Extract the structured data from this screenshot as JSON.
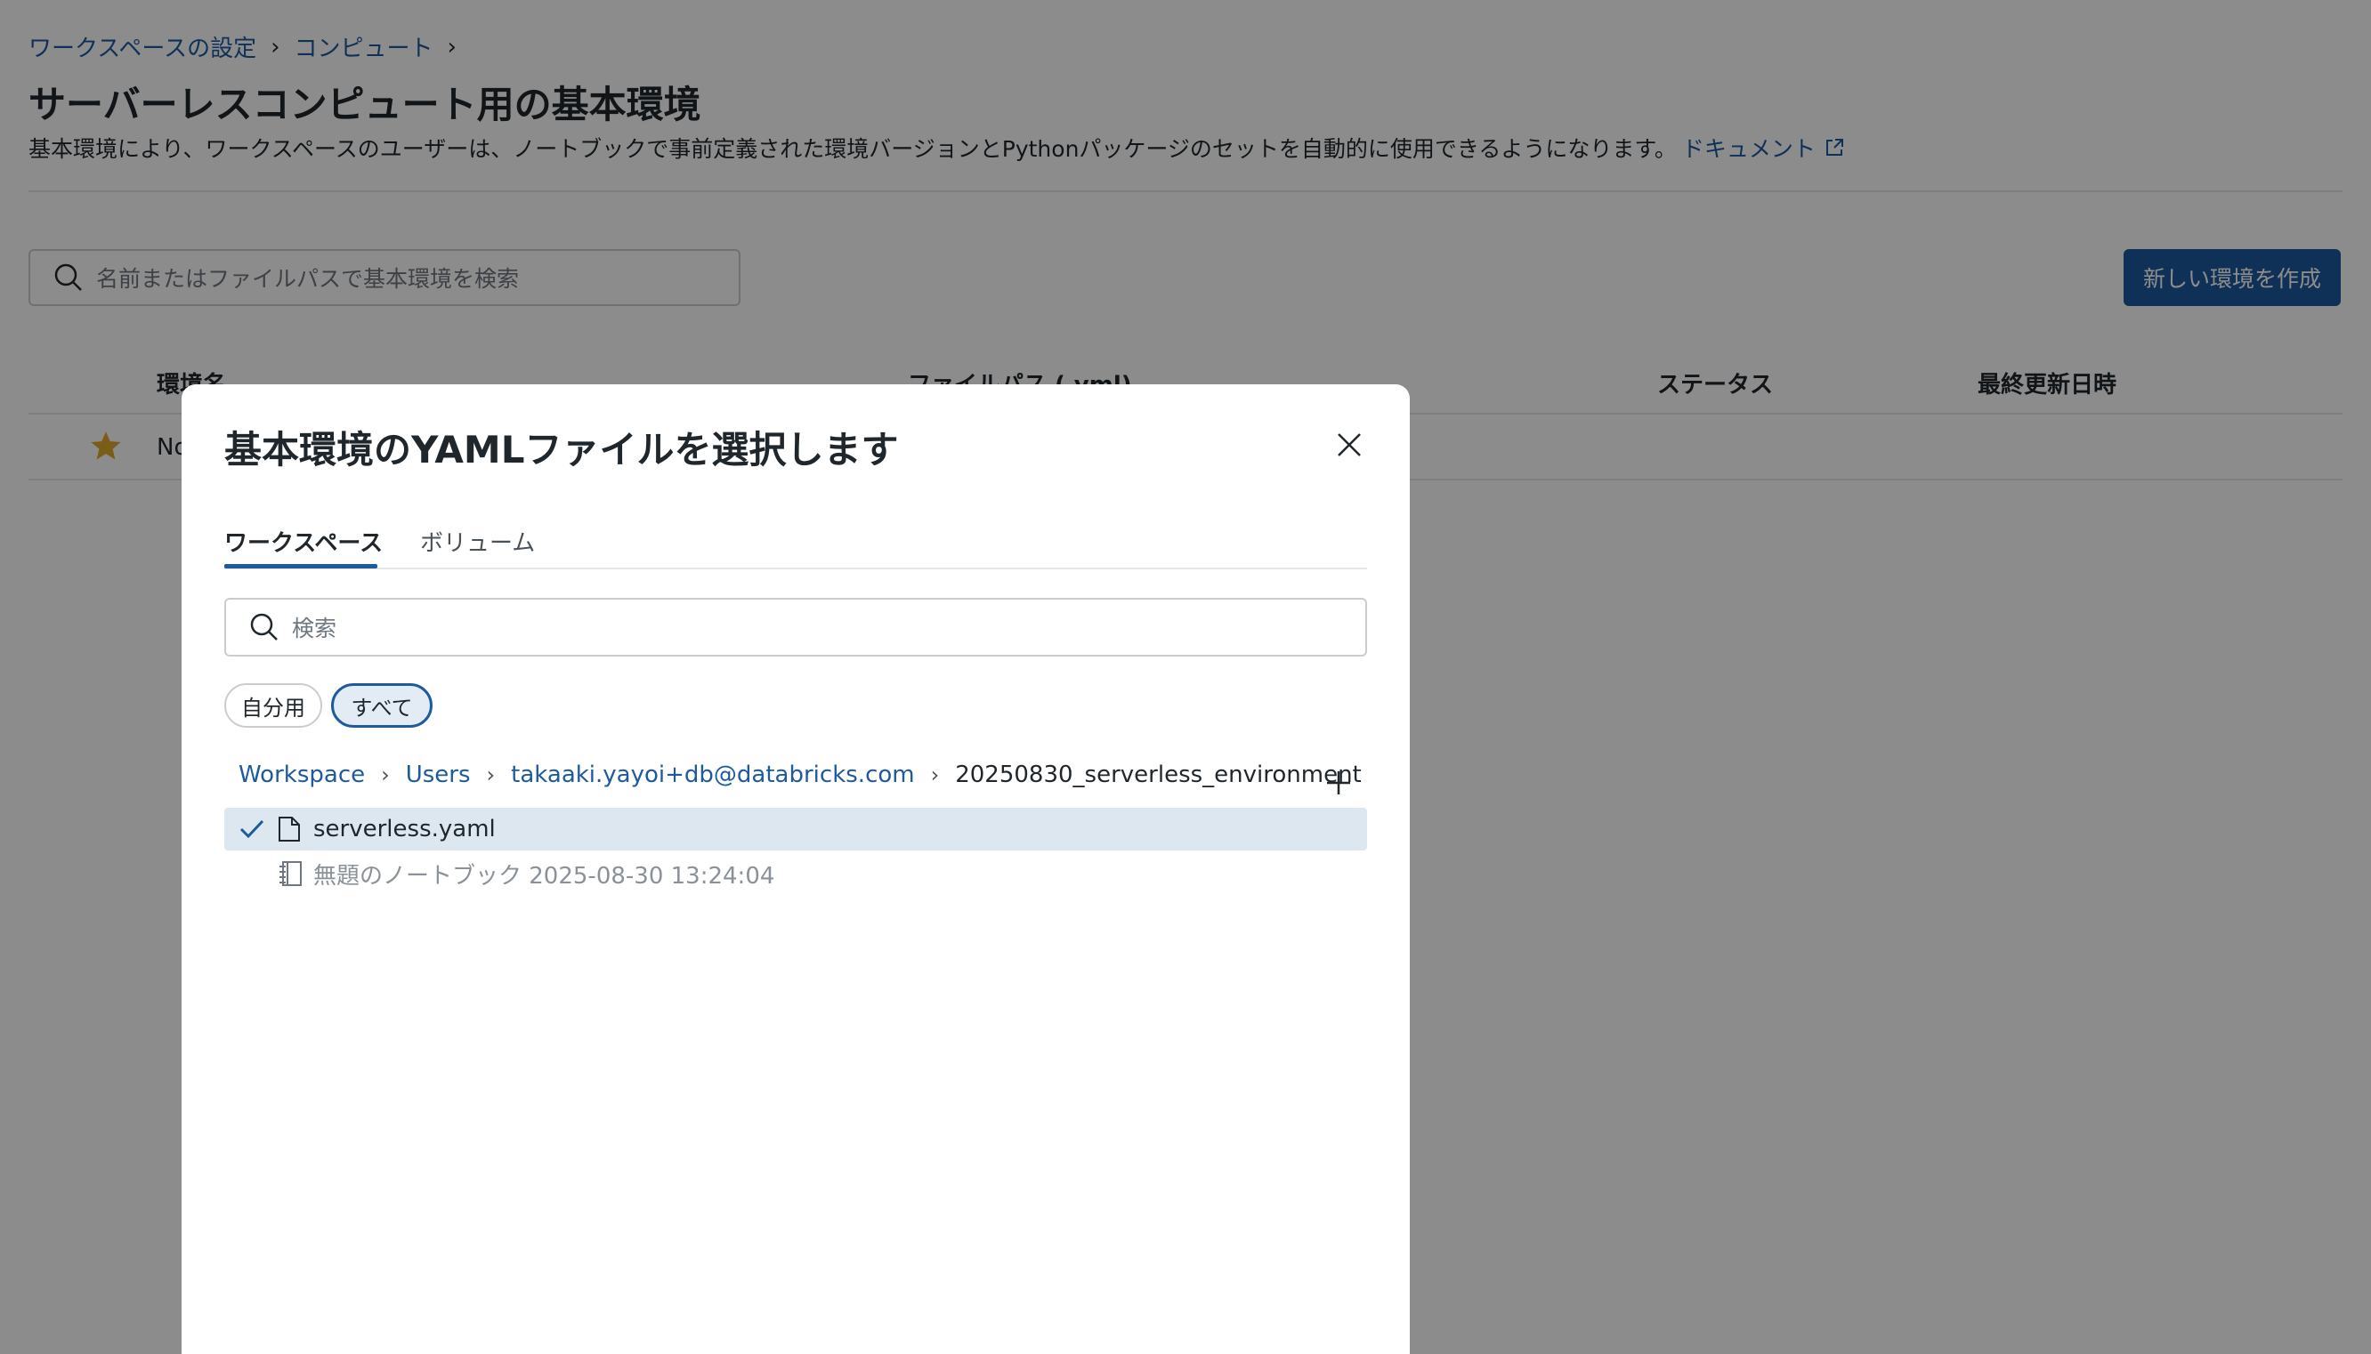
{
  "breadcrumb": {
    "items": [
      "ワークスペースの設定",
      "コンピュート"
    ],
    "separator": "›"
  },
  "page": {
    "title": "サーバーレスコンピュート用の基本環境",
    "description": "基本環境により、ワークスペースのユーザーは、ノートブックで事前定義された環境バージョンとPythonパッケージのセットを自動的に使用できるようになります。",
    "doc_link": "ドキュメント",
    "search_placeholder": "名前またはファイルパスで基本環境を検索",
    "create_button": "新しい環境を作成"
  },
  "table": {
    "headers": [
      "環境名",
      "ファイルパス (.yml)",
      "ステータス",
      "最終更新日時"
    ],
    "rows": [
      {
        "name": "No"
      }
    ]
  },
  "modal": {
    "title": "基本環境のYAMLファイルを選択します",
    "tabs": [
      "ワークスペース",
      "ボリューム"
    ],
    "search_placeholder": "検索",
    "filters": [
      "自分用",
      "すべて"
    ],
    "path": [
      "Workspace",
      "Users",
      "takaaki.yayoi+db@databricks.com",
      "20250830_serverless_environment"
    ],
    "path_separator": "›",
    "files": [
      {
        "name": "serverless.yaml",
        "icon": "file-icon",
        "selected": true
      },
      {
        "name": "無題のノートブック 2025-08-30 13:24:04",
        "icon": "notebook-icon",
        "selected": false
      }
    ]
  },
  "colors": {
    "accent": "#1e5a9e",
    "overlay": "rgba(0,0,0,0.45)",
    "selected_row": "#dde7f0",
    "star": "#e0a92a"
  }
}
